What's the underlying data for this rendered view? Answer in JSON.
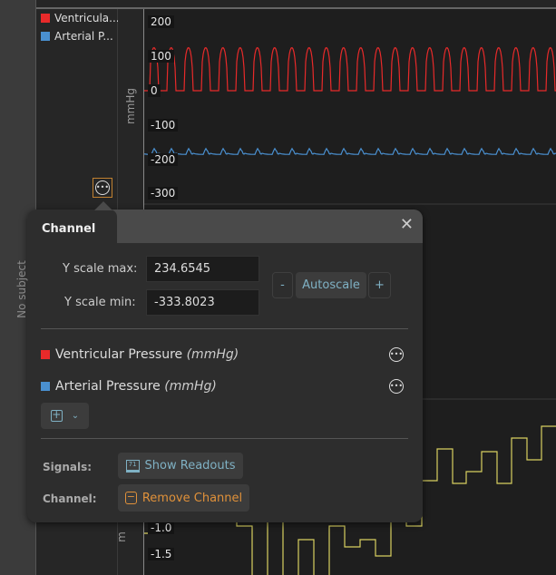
{
  "legend": [
    {
      "label": "Ventricula...",
      "color": "#e82a2a"
    },
    {
      "label": "Arterial P...",
      "color": "#4a90d0"
    }
  ],
  "top_axis": {
    "unit": "mmHg",
    "ticks": [
      "200",
      "100",
      "0",
      "-100",
      "-200",
      "-300"
    ]
  },
  "side_text": "No subject",
  "bottom_axis": {
    "unit": "m",
    "ticks": [
      "-1.0",
      "-1.5"
    ]
  },
  "popup": {
    "tab": "Channel",
    "close": "✕",
    "ymax_label": "Y scale max:",
    "ymax_value": "234.6545",
    "ymin_label": "Y scale min:",
    "ymin_value": "-333.8023",
    "minus": "-",
    "autoscale": "Autoscale",
    "plus": "+",
    "signals": [
      {
        "name": "Ventricular Pressure",
        "unit": "(mmHg)",
        "color": "#e82a2a"
      },
      {
        "name": "Arterial Pressure",
        "unit": "(mmHg)",
        "color": "#4a90d0"
      }
    ],
    "signals_label": "Signals:",
    "show_readouts": "Show Readouts",
    "readout_icon_text": "71",
    "channel_label": "Channel:",
    "remove_channel": "Remove Channel"
  },
  "colors": {
    "accent": "#7fb1c4",
    "remove": "#e0913a",
    "trace3": "#d8d060"
  }
}
